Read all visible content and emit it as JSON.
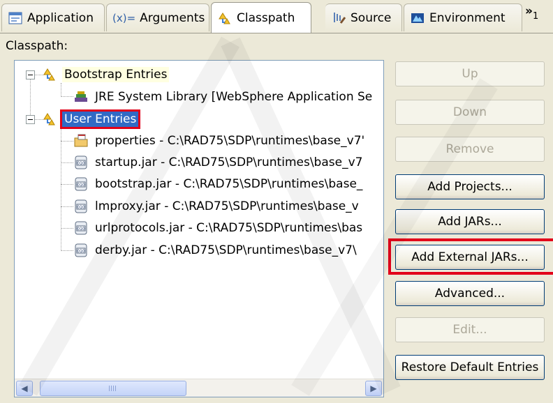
{
  "tabs": [
    {
      "label": "Application",
      "icon": "application-icon",
      "active": false
    },
    {
      "label": "Arguments",
      "icon": "arguments-icon",
      "prefix": "(x)=",
      "active": false
    },
    {
      "label": "Classpath",
      "icon": "classpath-icon",
      "active": true
    },
    {
      "label": "Source",
      "icon": "source-icon",
      "active": false
    },
    {
      "label": "Environment",
      "icon": "environment-icon",
      "active": false
    }
  ],
  "tab_overflow": {
    "symbol": "»",
    "count": "1"
  },
  "section_label": "Classpath:",
  "tree": {
    "bootstrap": {
      "label": "Bootstrap Entries",
      "children": [
        "JRE System Library [WebSphere Application Se"
      ]
    },
    "user": {
      "label": "User Entries",
      "children": [
        "properties - C:\\RAD75\\SDP\\runtimes\\base_v7'",
        "startup.jar - C:\\RAD75\\SDP\\runtimes\\base_v7",
        "bootstrap.jar - C:\\RAD75\\SDP\\runtimes\\base_",
        "lmproxy.jar - C:\\RAD75\\SDP\\runtimes\\base_v",
        "urlprotocols.jar - C:\\RAD75\\SDP\\runtimes\\bas",
        "derby.jar - C:\\RAD75\\SDP\\runtimes\\base_v7\\"
      ]
    }
  },
  "buttons": {
    "up": "Up",
    "down": "Down",
    "remove": "Remove",
    "add_projects": "Add Projects...",
    "add_jars": "Add JARs...",
    "add_external_jars": "Add External JARs...",
    "advanced": "Advanced...",
    "edit": "Edit...",
    "restore_defaults": "Restore Default Entries"
  },
  "colors": {
    "selection": "#316ac5",
    "callout_red": "#e2001a",
    "window_bg": "#ece9d8"
  }
}
